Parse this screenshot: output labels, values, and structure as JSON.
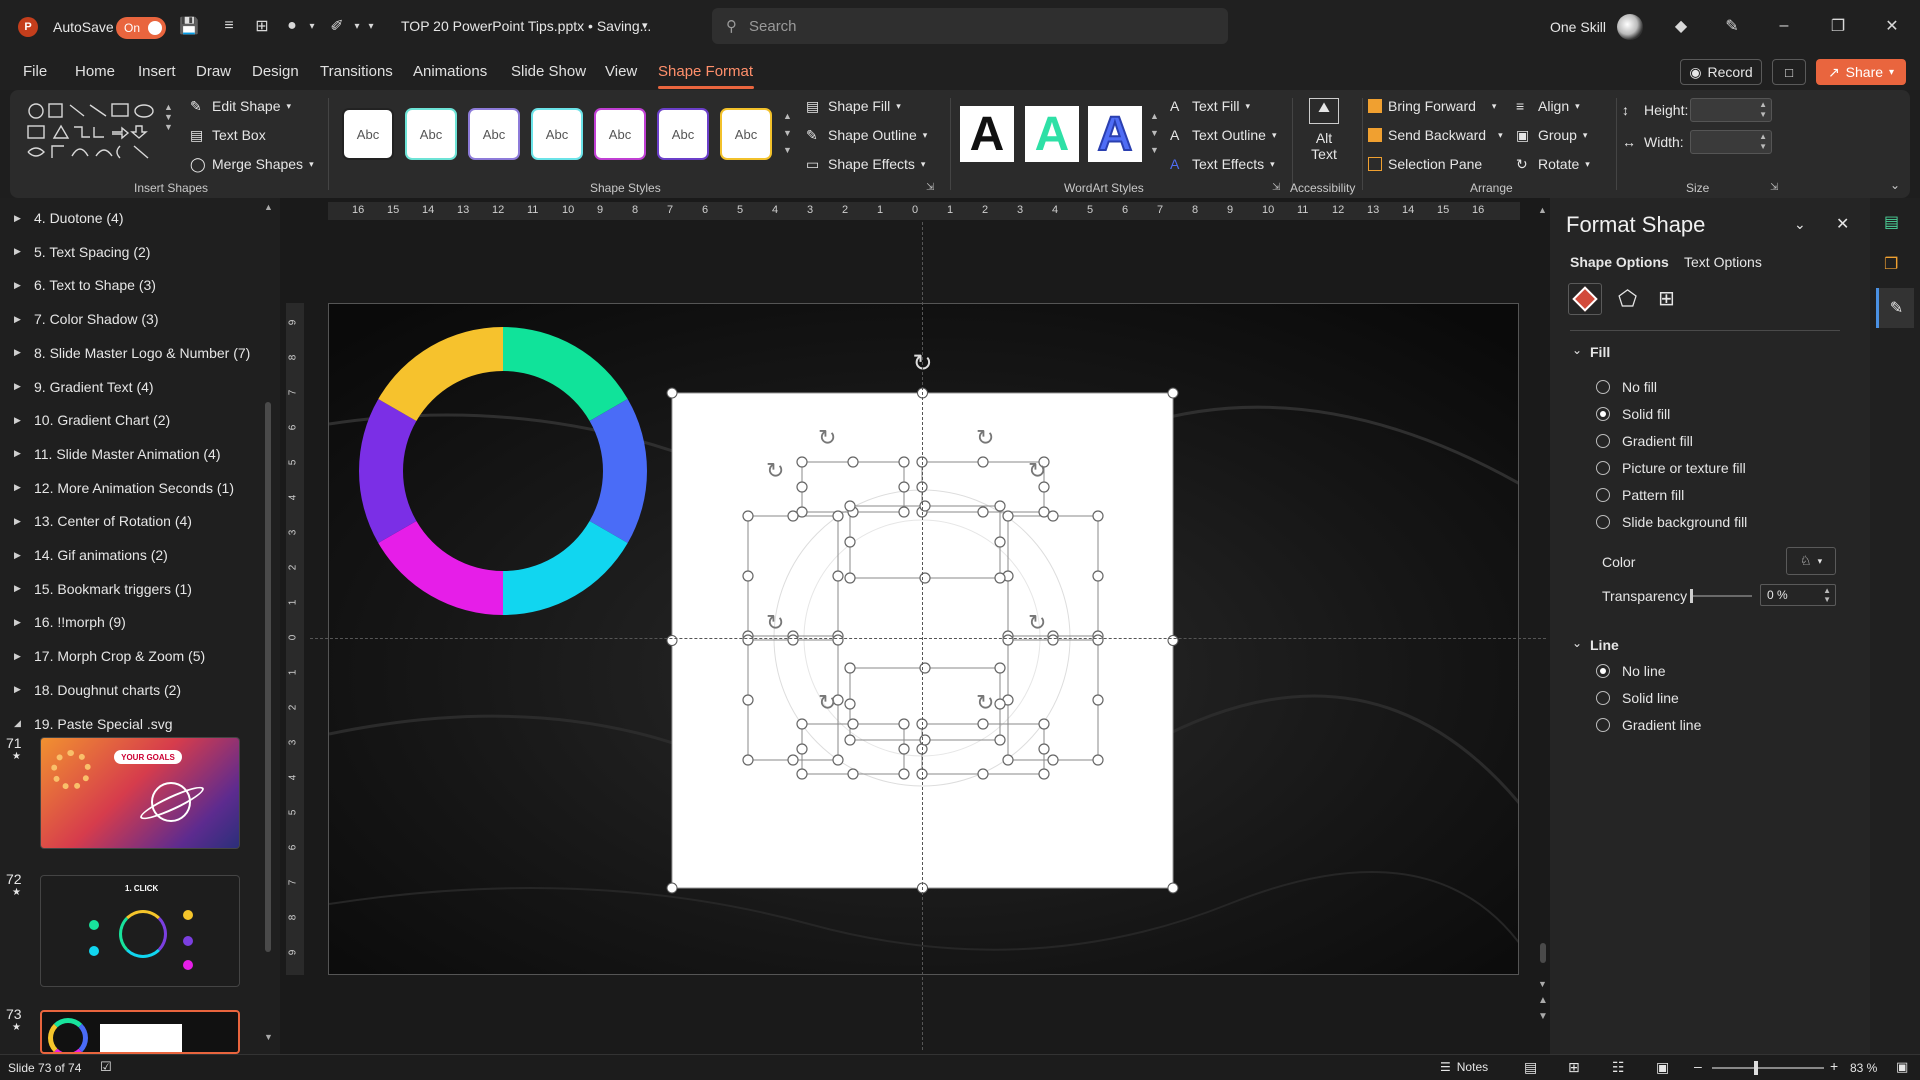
{
  "app": {
    "autosave_label": "AutoSave",
    "autosave_state": "On",
    "doc_title": "TOP 20 PowerPoint Tips.pptx • Saving...",
    "search_placeholder": "Search",
    "user_name": "One Skill",
    "accent": "#e9653e"
  },
  "buttons": {
    "record": "Record",
    "share": "Share"
  },
  "menu": [
    "File",
    "Home",
    "Insert",
    "Draw",
    "Design",
    "Transitions",
    "Animations",
    "Slide Show",
    "View",
    "Shape Format"
  ],
  "ribbon": {
    "insert_shapes": {
      "edit_shape": "Edit Shape",
      "text_box": "Text Box",
      "merge_shapes": "Merge Shapes",
      "label": "Insert Shapes"
    },
    "shape_styles": {
      "samples": [
        "Abc",
        "Abc",
        "Abc",
        "Abc",
        "Abc",
        "Abc",
        "Abc"
      ],
      "shape_fill": "Shape Fill",
      "shape_outline": "Shape Outline",
      "shape_effects": "Shape Effects",
      "label": "Shape Styles"
    },
    "wordart": {
      "letters": [
        "A",
        "A",
        "A"
      ],
      "text_fill": "Text Fill",
      "text_outline": "Text Outline",
      "text_effects": "Text Effects",
      "label": "WordArt Styles"
    },
    "accessibility": {
      "alt_text_1": "Alt",
      "alt_text_2": "Text",
      "label": "Accessibility"
    },
    "arrange": {
      "bring_forward": "Bring Forward",
      "send_backward": "Send Backward",
      "selection_pane": "Selection Pane",
      "align": "Align",
      "group": "Group",
      "rotate": "Rotate",
      "label": "Arrange"
    },
    "size": {
      "height": "Height:",
      "width": "Width:",
      "label": "Size"
    }
  },
  "sections": [
    "4. Duotone (4)",
    "5. Text Spacing (2)",
    "6. Text to Shape (3)",
    "7. Color Shadow (3)",
    "8. Slide Master Logo & Number (7)",
    "9. Gradient Text (4)",
    "10. Gradient Chart (2)",
    "11. Slide Master Animation (4)",
    "12. More Animation Seconds (1)",
    "13. Center of Rotation (4)",
    "14. Gif animations (2)",
    "15. Bookmark triggers (1)",
    "16. !!morph (9)",
    "17. Morph Crop & Zoom (5)",
    "18. Doughnut charts (2)",
    "19. Paste Special .svg"
  ],
  "thumbnails": [
    {
      "num": "71",
      "title": "YOUR GOALS"
    },
    {
      "num": "72",
      "title": "1. CLICK"
    },
    {
      "num": "73",
      "title": ""
    }
  ],
  "rulers": {
    "h": [
      "16",
      "15",
      "14",
      "13",
      "12",
      "11",
      "10",
      "9",
      "8",
      "7",
      "6",
      "5",
      "4",
      "3",
      "2",
      "1",
      "0",
      "1",
      "2",
      "3",
      "4",
      "5",
      "6",
      "7",
      "8",
      "9",
      "10",
      "11",
      "12",
      "13",
      "14",
      "15",
      "16"
    ],
    "v": [
      "9",
      "8",
      "7",
      "6",
      "5",
      "4",
      "3",
      "2",
      "1",
      "0",
      "1",
      "2",
      "3",
      "4",
      "5",
      "6",
      "7",
      "8",
      "9"
    ]
  },
  "format_panel": {
    "title": "Format Shape",
    "tab_shape": "Shape Options",
    "tab_text": "Text Options",
    "fill_header": "Fill",
    "fill_options": [
      "No fill",
      "Solid fill",
      "Gradient fill",
      "Picture or texture fill",
      "Pattern fill",
      "Slide background fill"
    ],
    "fill_selected": 1,
    "color_label": "Color",
    "transparency_label": "Transparency",
    "transparency_value": "0 %",
    "line_header": "Line",
    "line_options": [
      "No line",
      "Solid line",
      "Gradient line"
    ],
    "line_selected": 0
  },
  "status": {
    "slide_info": "Slide 73 of 74",
    "notes": "Notes",
    "zoom": "83 %"
  },
  "doughnut_colors": [
    "#10e39a",
    "#4a6cf7",
    "#11d6f0",
    "#e61ee8",
    "#7b2fe6",
    "#f6c22d"
  ]
}
